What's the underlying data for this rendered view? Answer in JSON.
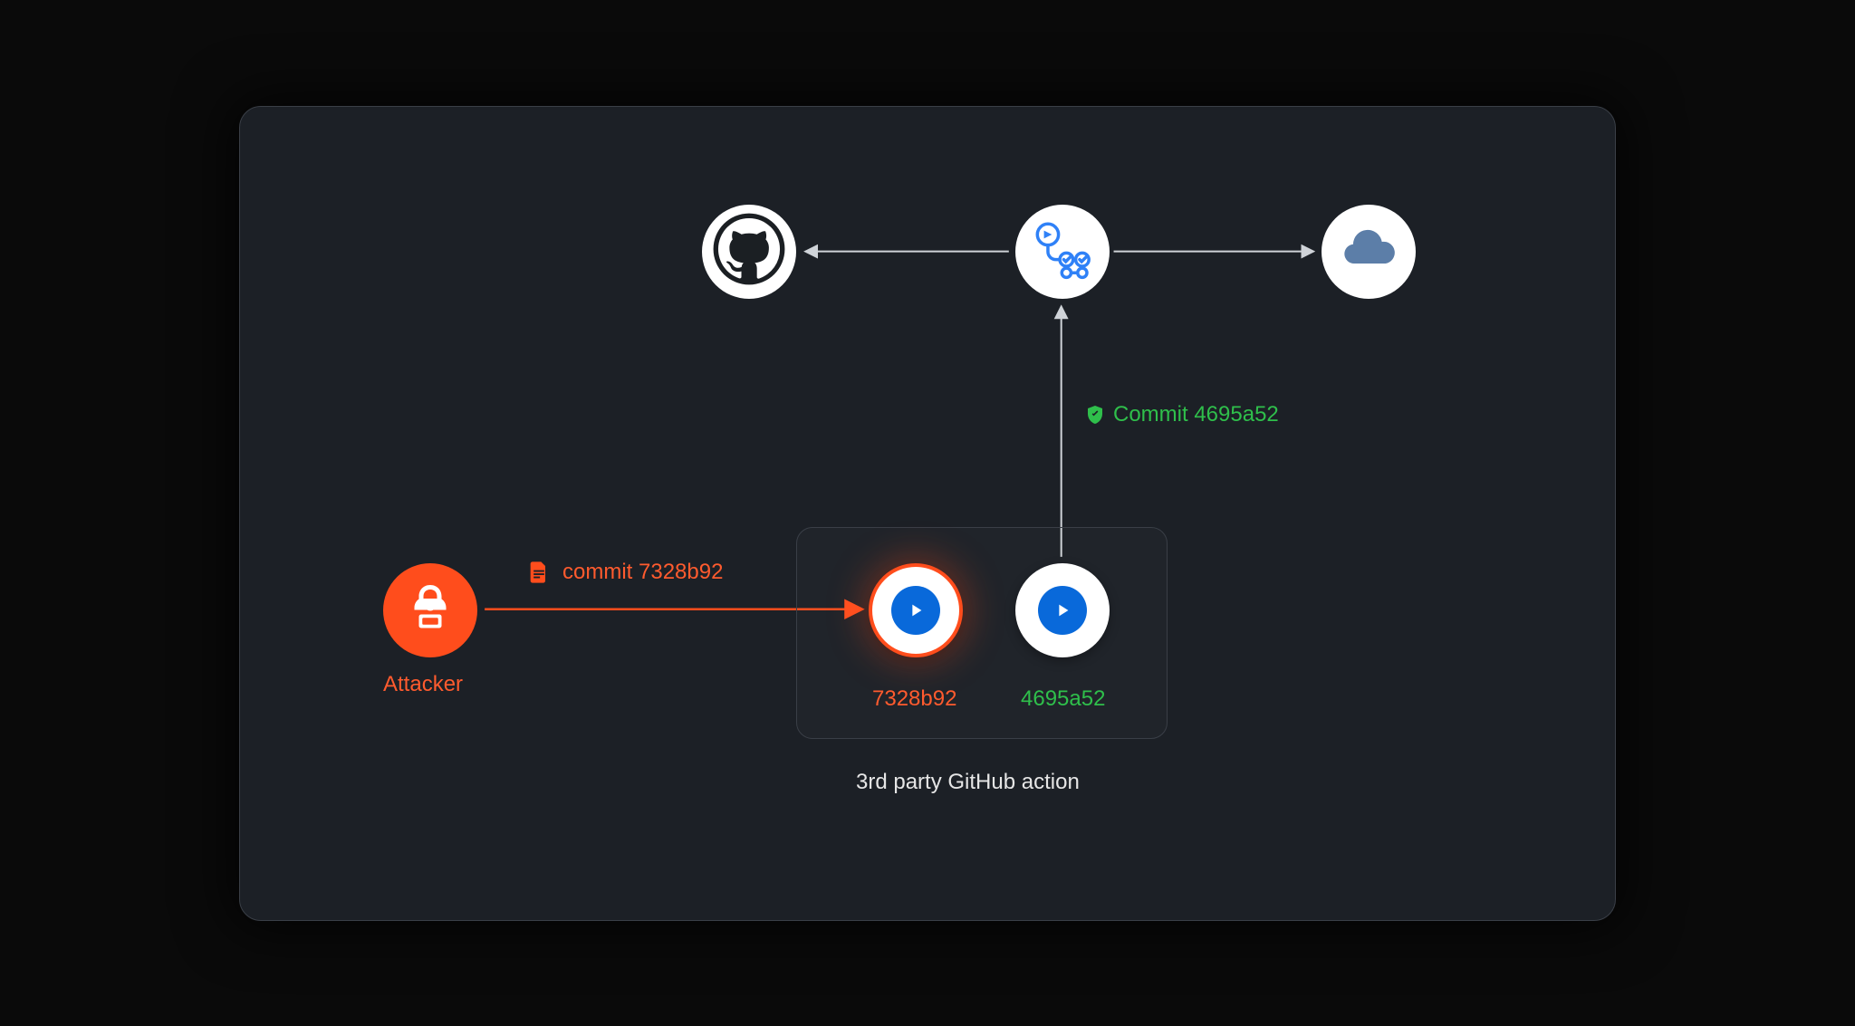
{
  "attacker": {
    "label": "Attacker"
  },
  "malicious_commit": {
    "label": "commit 7328b92",
    "hash": "7328b92"
  },
  "verified_commit": {
    "label": "Commit 4695a52",
    "hash": "4695a52"
  },
  "bad_action": {
    "hash_label": "7328b92"
  },
  "good_action": {
    "hash_label": "4695a52"
  },
  "action_box": {
    "caption": "3rd party GitHub action"
  },
  "nodes": {
    "github": "github-repo",
    "workflow": "github-actions-workflow",
    "cloud": "cloud-deploy-target"
  },
  "colors": {
    "accent_orange": "#ff4d1c",
    "accent_green": "#2fbf4b",
    "accent_blue": "#0969da",
    "cloud_blue": "#5c7ea8",
    "panel_bg": "#1c2026",
    "panel_border": "#3a3f47"
  }
}
